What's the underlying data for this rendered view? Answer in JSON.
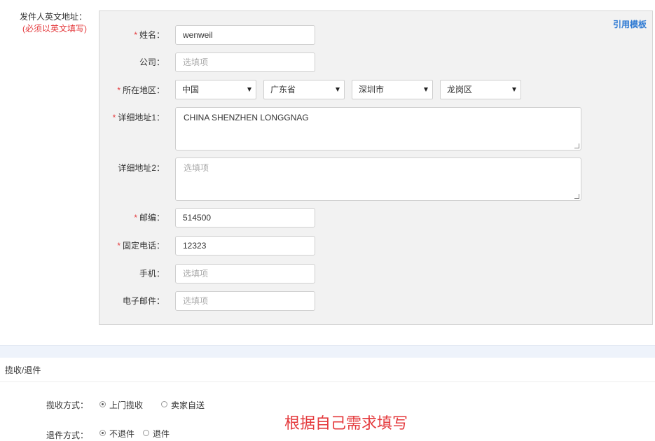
{
  "sender": {
    "section_label": "发件人英文地址：",
    "section_note": "(必须以英文填写)",
    "template_link": "引用模板",
    "required_mark": "*",
    "fields": {
      "name": {
        "label": "姓名：",
        "value": "wenweil"
      },
      "company": {
        "label": "公司：",
        "placeholder": "选填项"
      },
      "region": {
        "label": "所在地区：",
        "country": "中国",
        "province": "广东省",
        "city": "深圳市",
        "district": "龙岗区"
      },
      "address1": {
        "label": "详细地址1：",
        "value": "CHINA SHENZHEN LONGGNAG"
      },
      "address2": {
        "label": "详细地址2：",
        "placeholder": "选填项"
      },
      "postcode": {
        "label": "邮编：",
        "value": "514500"
      },
      "phone": {
        "label": "固定电话：",
        "value": "12323"
      },
      "mobile": {
        "label": "手机：",
        "placeholder": "选填项"
      },
      "email": {
        "label": "电子邮件：",
        "placeholder": "选填项"
      }
    }
  },
  "pickup": {
    "title": "揽收/退件",
    "pickup_method": {
      "label": "揽收方式：",
      "options": [
        {
          "text": "上门揽收",
          "checked": true
        },
        {
          "text": "卖家自送",
          "checked": false
        }
      ]
    },
    "return_method": {
      "label": "退件方式：",
      "options": [
        {
          "text": "不退件",
          "checked": true
        },
        {
          "text": "退件",
          "checked": false
        }
      ]
    }
  },
  "annotation": "根据自己需求填写",
  "colors": {
    "required": "#e4393c",
    "link": "#2e7ad3",
    "panel_bg": "#f2f2f2"
  }
}
